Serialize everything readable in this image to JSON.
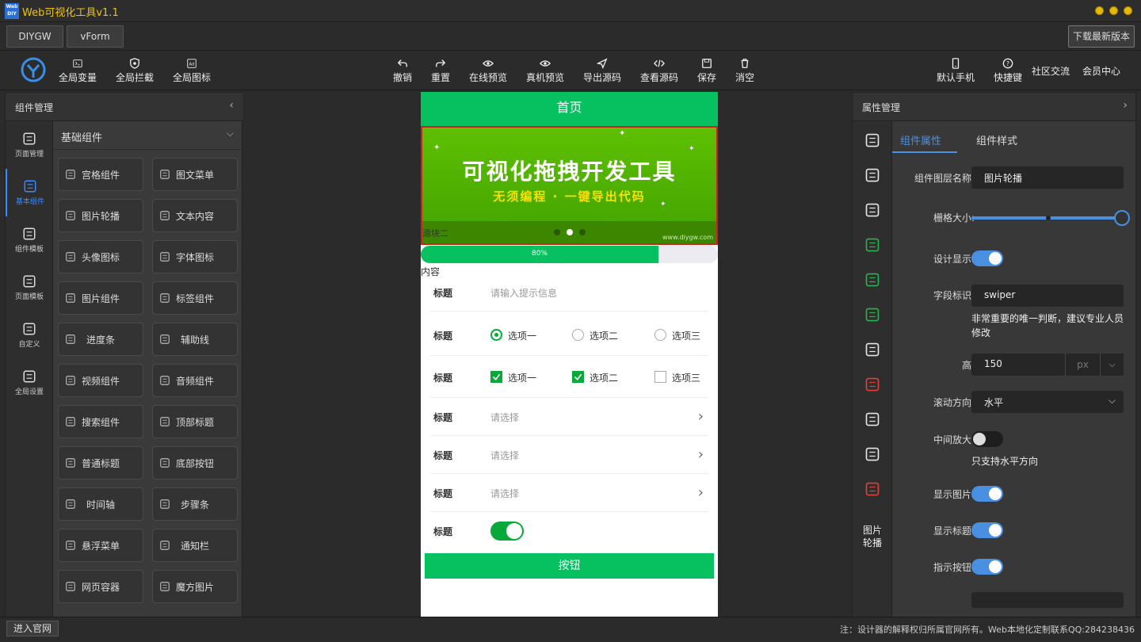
{
  "app": {
    "logo_text": "Web DIY",
    "title": "Web可视化工具v1.1"
  },
  "tabs": [
    {
      "label": "DIYGW"
    },
    {
      "label": "vForm"
    }
  ],
  "download_label": "下载最新版本",
  "toolbar": {
    "left": [
      {
        "label": "全局变量",
        "icon": "variable-icon"
      },
      {
        "label": "全局拦截",
        "icon": "shield-icon"
      },
      {
        "label": "全局图标",
        "icon": "icon-set-icon"
      }
    ],
    "center": [
      {
        "label": "撤销",
        "icon": "undo-icon"
      },
      {
        "label": "重置",
        "icon": "redo-icon"
      },
      {
        "label": "在线预览",
        "icon": "eye-icon"
      },
      {
        "label": "真机预览",
        "icon": "eye-icon"
      },
      {
        "label": "导出源码",
        "icon": "send-icon"
      },
      {
        "label": "查看源码",
        "icon": "code-icon"
      },
      {
        "label": "保存",
        "icon": "save-icon"
      },
      {
        "label": "消空",
        "icon": "trash-icon"
      }
    ],
    "right": [
      {
        "label": "默认手机",
        "icon": "phone-icon"
      },
      {
        "label": "快捷键",
        "icon": "help-icon"
      },
      {
        "label": "社区交流"
      },
      {
        "label": "会员中心"
      }
    ]
  },
  "left_panel": {
    "title": "组件管理",
    "rail": [
      {
        "label": "页面管理",
        "icon": "pencil-icon"
      },
      {
        "label": "基本组件",
        "icon": "component-icon",
        "active": true
      },
      {
        "label": "组件模板",
        "icon": "database-icon"
      },
      {
        "label": "页面模板",
        "icon": "database-icon"
      },
      {
        "label": "自定义",
        "icon": "cloud-upload-icon"
      },
      {
        "label": "全局设置",
        "icon": "pencil-icon"
      }
    ],
    "group_title": "基础组件",
    "components": [
      {
        "label": "宫格组件",
        "icon": "grid-icon"
      },
      {
        "label": "图文菜单",
        "icon": "list-icon"
      },
      {
        "label": "图片轮播",
        "icon": "image-carousel-icon"
      },
      {
        "label": "文本内容",
        "icon": "text-icon"
      },
      {
        "label": "头像图标",
        "icon": "avatar-icon"
      },
      {
        "label": "字体图标",
        "icon": "smile-icon"
      },
      {
        "label": "图片组件",
        "icon": "image-icon"
      },
      {
        "label": "标签组件",
        "icon": "tag-icon"
      },
      {
        "label": "进度条",
        "icon": "progress-icon"
      },
      {
        "label": "辅助线",
        "icon": "divider-icon"
      },
      {
        "label": "视频组件",
        "icon": "video-icon"
      },
      {
        "label": "音频组件",
        "icon": "music-icon"
      },
      {
        "label": "搜索组件",
        "icon": "search-icon"
      },
      {
        "label": "顶部标题",
        "icon": "title-icon"
      },
      {
        "label": "普通标题",
        "icon": "title-icon"
      },
      {
        "label": "底部按钮",
        "icon": "bottom-button-icon"
      },
      {
        "label": "时间轴",
        "icon": "timeline-icon"
      },
      {
        "label": "步骤条",
        "icon": "steps-icon"
      },
      {
        "label": "悬浮菜单",
        "icon": "float-menu-icon"
      },
      {
        "label": "通知栏",
        "icon": "speaker-icon"
      },
      {
        "label": "网页容器",
        "icon": "globe-icon"
      },
      {
        "label": "魔方图片",
        "icon": "cube-image-icon"
      }
    ]
  },
  "phone": {
    "nav_title": "首页",
    "swiper": {
      "headline": "可视化拖拽开发工具",
      "subline": "无须编程 · 一键导出代码",
      "caption": "滑块二",
      "watermark": "www.diygw.com",
      "active_dot": 1,
      "dot_count": 3
    },
    "progress": {
      "value": 0.8,
      "label": "80%"
    },
    "content_label": "内容",
    "form": [
      {
        "label": "标题",
        "type": "input",
        "placeholder": "请输入提示信息"
      },
      {
        "label": "标题",
        "type": "radio",
        "options": [
          "选项一",
          "选项二",
          "选项三"
        ],
        "checked": [
          true,
          false,
          false
        ]
      },
      {
        "label": "标题",
        "type": "checkbox",
        "options": [
          "选项一",
          "选项二",
          "选项三"
        ],
        "checked": [
          true,
          true,
          false
        ]
      },
      {
        "label": "标题",
        "type": "select",
        "placeholder": "请选择"
      },
      {
        "label": "标题",
        "type": "select",
        "placeholder": "请选择"
      },
      {
        "label": "标题",
        "type": "select",
        "placeholder": "请选择"
      },
      {
        "label": "标题",
        "type": "switch",
        "on": true
      }
    ],
    "button_label": "按钮"
  },
  "right_panel": {
    "title": "属性管理",
    "rail_icons": [
      "upload-icon",
      "download-icon",
      "copy-icon",
      "puzzle-icon",
      "add-file-icon",
      "files-icon",
      "unlock-icon",
      "delete-icon",
      "link-icon",
      "layers-icon",
      "settings-icon"
    ],
    "rail_caption": "图片轮播",
    "tabs": [
      {
        "label": "组件属性",
        "active": true
      },
      {
        "label": "组件样式"
      }
    ],
    "props": {
      "layer_name_label": "组件图层名称:",
      "layer_name_value": "图片轮播",
      "grid_label": "栅格大小:",
      "grid_value": 1.0,
      "design_show_label": "设计显示:",
      "design_show_on": true,
      "field_id_label": "字段标识:",
      "field_id_value": "swiper",
      "field_id_hint": "非常重要的唯一判断，建议专业人员修改",
      "height_label": "高:",
      "height_value": "150",
      "height_unit": "px",
      "scroll_dir_label": "滚动方向:",
      "scroll_dir_value": "水平",
      "center_zoom_label": "中间放大:",
      "center_zoom_on": false,
      "center_zoom_hint": "只支持水平方向",
      "show_image_label": "显示图片:",
      "show_image_on": true,
      "show_title_label": "显示标题:",
      "show_title_on": true,
      "indicator_label": "指示按钮:",
      "indicator_on": true
    }
  },
  "statusbar": {
    "enter_site": "进入官网",
    "notice": "注：设计器的解释权归所属官网所有。Web本地化定制联系QQ:284238436"
  },
  "colors": {
    "brand_green": "#07c160",
    "accent_blue": "#4a90e2",
    "banner_green": "#52b300",
    "title_yellow": "#f2c200"
  }
}
